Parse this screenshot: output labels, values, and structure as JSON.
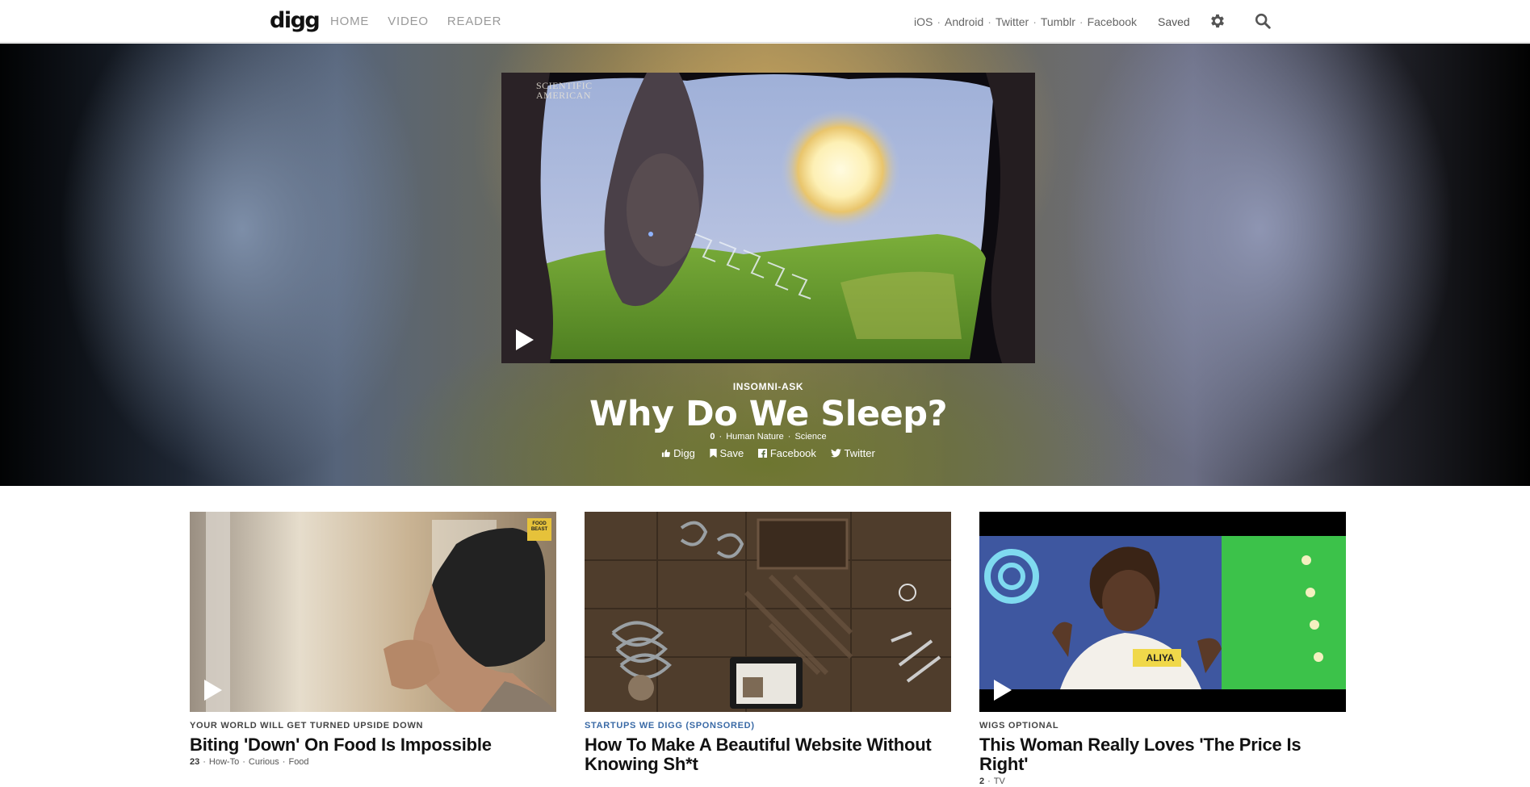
{
  "nav": {
    "logo": "digg",
    "main": [
      "HOME",
      "VIDEO",
      "READER"
    ],
    "social": [
      "iOS",
      "Android",
      "Twitter",
      "Tumblr",
      "Facebook"
    ],
    "saved": "Saved",
    "icons": [
      "gear-icon",
      "search-icon"
    ]
  },
  "hero": {
    "watermark_line1": "SCIENTIFIC",
    "watermark_line2": "AMERICAN",
    "kicker": "INSOMNI-ASK",
    "title": "Why Do We Sleep?",
    "count": "0",
    "tags": [
      "Human Nature",
      "Science"
    ],
    "actions": [
      "Digg",
      "Save",
      "Facebook",
      "Twitter"
    ]
  },
  "cards": [
    {
      "kicker": "YOUR WORLD WILL GET TURNED UPSIDE DOWN",
      "title": "Biting 'Down' On Food Is Impossible",
      "count": "23",
      "tags": [
        "How-To",
        "Curious",
        "Food"
      ],
      "badge": "FOOD BEAST"
    },
    {
      "kicker": "STARTUPS WE DIGG (SPONSORED)",
      "title": "How To Make A Beautiful Website Without Knowing Sh*t",
      "count": "",
      "tags": []
    },
    {
      "kicker": "WIGS OPTIONAL",
      "title": "This Woman Really Loves 'The Price Is Right'",
      "count": "2",
      "tags": [
        "TV"
      ],
      "shirt_text": "ALIYA"
    }
  ],
  "colors": {
    "sponsored": "#3a6aa6",
    "nav_text": "#9a9a9a"
  }
}
